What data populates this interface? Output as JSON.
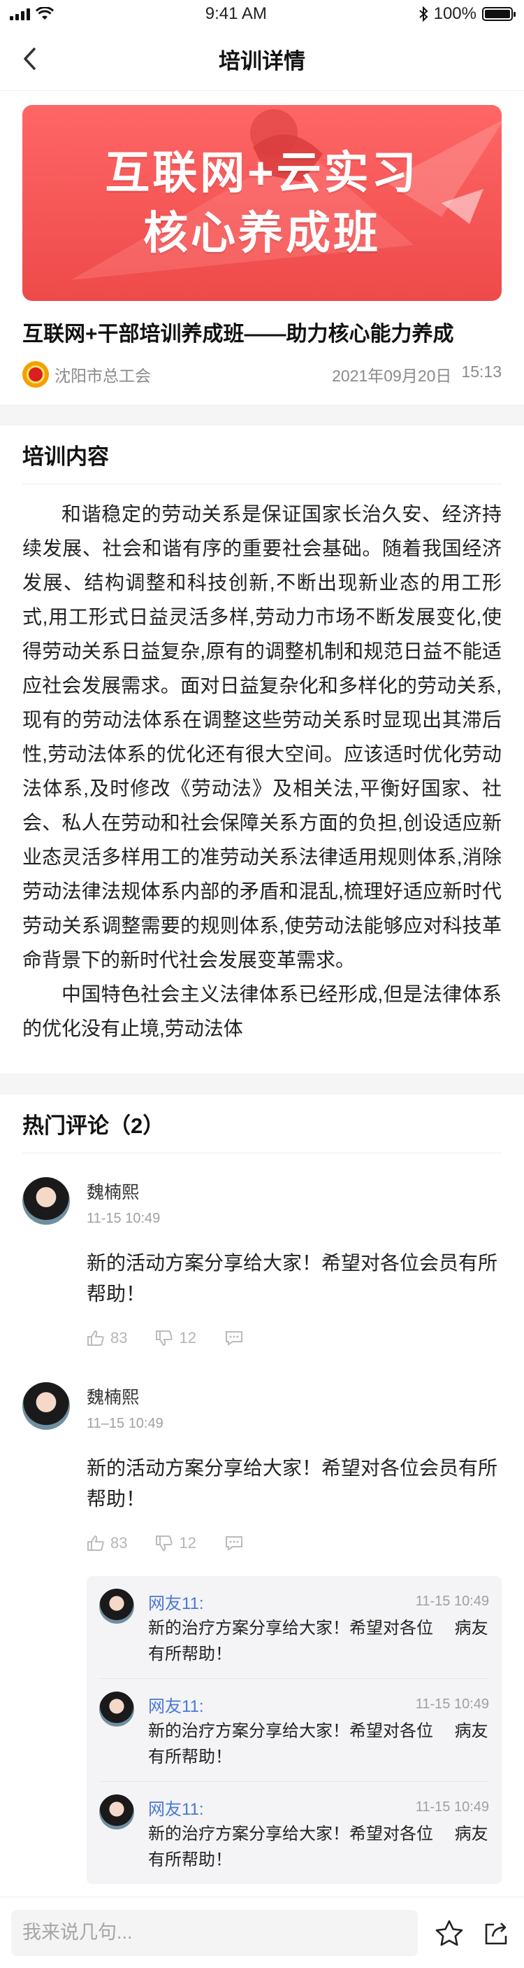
{
  "status_bar": {
    "time": "9:41 AM",
    "battery_text": "100%",
    "battery_level": 1.0
  },
  "nav": {
    "title": "培训详情",
    "back_icon": "chevron-left-icon"
  },
  "hero": {
    "line1": "互联网+云实习",
    "line2": "核心养成班"
  },
  "article": {
    "title": "互联网+干部培训养成班——助力核心能力养成",
    "org": "沈阳市总工会",
    "date": "2021年09月20日",
    "time": "15:13"
  },
  "content": {
    "heading": "培训内容",
    "paragraphs": [
      "和谐稳定的劳动关系是保证国家长治久安、经济持续发展、社会和谐有序的重要社会基础。随着我国经济发展、结构调整和科技创新,不断出现新业态的用工形式,用工形式日益灵活多样,劳动力市场不断发展变化,使得劳动关系日益复杂,原有的调整机制和规范日益不能适应社会发展需求。面对日益复杂化和多样化的劳动关系,现有的劳动法体系在调整这些劳动关系时显现出其滞后性,劳动法体系的优化还有很大空间。应该适时优化劳动法体系,及时修改《劳动法》及相关法,平衡好国家、社会、私人在劳动和社会保障关系方面的负担,创设适应新业态灵活多样用工的准劳动关系法律适用规则体系,消除劳动法律法规体系内部的矛盾和混乱,梳理好适应新时代劳动关系调整需要的规则体系,使劳动法能够应对科技革命背景下的新时代社会发展变革需求。",
      "中国特色社会主义法律体系已经形成,但是法律体系的优化没有止境,劳动法体"
    ]
  },
  "comments_section": {
    "heading": "热门评论（2）",
    "comments": [
      {
        "name": "魏楠熙",
        "time": "11-15  10:49",
        "text": "新的活动方案分享给大家！希望对各位会员有所帮助！",
        "likes": "83",
        "dislikes": "12"
      },
      {
        "name": "魏楠熙",
        "time": "11–15  10:49",
        "text": "新的活动方案分享给大家！希望对各位会员有所帮助！",
        "likes": "83",
        "dislikes": "12",
        "replies": [
          {
            "name": "网友11:",
            "time": "11-15  10:49",
            "text": "新的治疗方案分享给大家！希望对各位　 病友有所帮助！"
          },
          {
            "name": "网友11:",
            "time": "11-15  10:49",
            "text": "新的治疗方案分享给大家！希望对各位　 病友有所帮助！"
          },
          {
            "name": "网友11:",
            "time": "11-15  10:49",
            "text": "新的治疗方案分享给大家！希望对各位　 病友有所帮助！"
          }
        ]
      }
    ]
  },
  "bottom_bar": {
    "input_placeholder": "我来说几句...",
    "icons": [
      "star-icon",
      "share-icon"
    ]
  }
}
